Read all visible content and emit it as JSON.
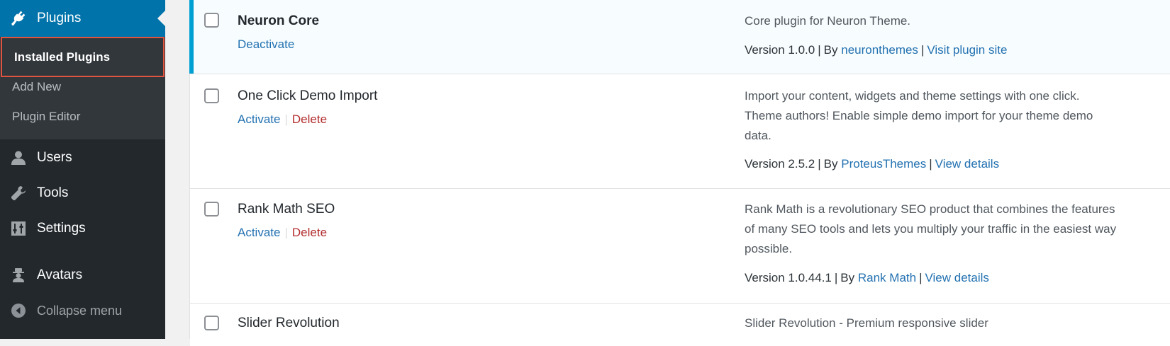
{
  "sidebar": {
    "plugins": {
      "label": "Plugins",
      "icon": "plugin-icon"
    },
    "submenu": {
      "installed": "Installed Plugins",
      "add_new": "Add New",
      "editor": "Plugin Editor"
    },
    "users": {
      "label": "Users",
      "icon": "user-icon"
    },
    "tools": {
      "label": "Tools",
      "icon": "wrench-icon"
    },
    "settings": {
      "label": "Settings",
      "icon": "settings-sliders-icon"
    },
    "avatars": {
      "label": "Avatars",
      "icon": "avatar-icon"
    },
    "collapse": {
      "label": "Collapse menu",
      "icon": "collapse-arrow-icon"
    }
  },
  "plugins": [
    {
      "name": "Neuron Core",
      "active": true,
      "action_deactivate": "Deactivate",
      "description": "Core plugin for Neuron Theme.",
      "version": "Version 1.0.0",
      "by": "By",
      "author": "neuronthemes",
      "link": "Visit plugin site"
    },
    {
      "name": "One Click Demo Import",
      "active": false,
      "action_activate": "Activate",
      "action_delete": "Delete",
      "description_lines": [
        "Import your content, widgets and theme settings with one click.",
        "Theme authors! Enable simple demo import for your theme demo",
        "data."
      ],
      "version": "Version 2.5.2",
      "by": "By",
      "author": "ProteusThemes",
      "link": "View details"
    },
    {
      "name": "Rank Math SEO",
      "active": false,
      "action_activate": "Activate",
      "action_delete": "Delete",
      "description_lines": [
        "Rank Math is a revolutionary SEO product that combines the features",
        "of many SEO tools and lets you multiply your traffic in the easiest way",
        "possible."
      ],
      "version": "Version 1.0.44.1",
      "by": "By",
      "author": "Rank Math",
      "link": "View details"
    },
    {
      "name": "Slider Revolution",
      "active": false,
      "description": "Slider Revolution - Premium responsive slider"
    }
  ],
  "colors": {
    "sidebar_bg": "#23282d",
    "submenu_bg": "#32373c",
    "accent": "#0073aa",
    "active_bar": "#00a0d2",
    "link": "#2271b1",
    "delete": "#b32d2e",
    "highlight_border": "#e0533f"
  }
}
